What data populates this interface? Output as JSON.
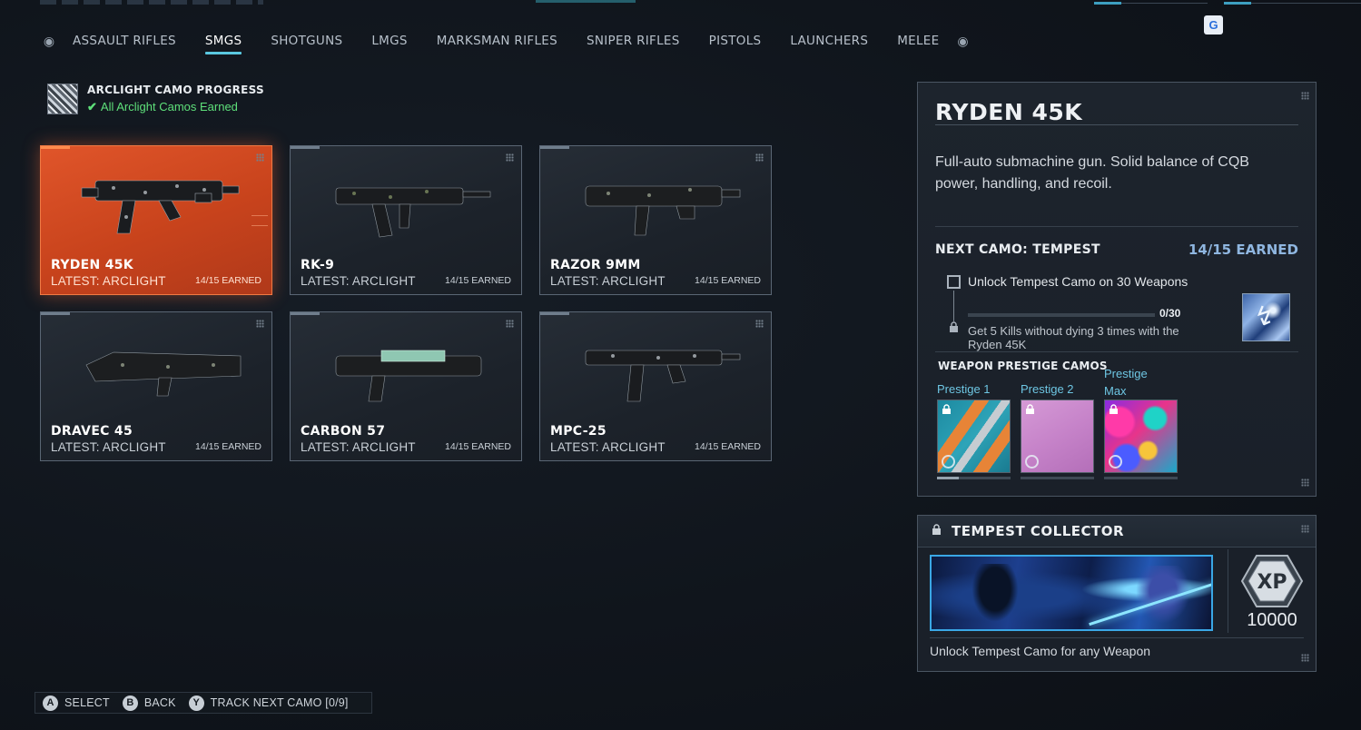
{
  "tabs": {
    "left_icon": "bumper-left-icon",
    "right_icon": "bumper-right-icon",
    "items": [
      "ASSAULT RIFLES",
      "SMGS",
      "SHOTGUNS",
      "LMGS",
      "MARKSMAN RIFLES",
      "SNIPER RIFLES",
      "PISTOLS",
      "LAUNCHERS",
      "MELEE"
    ],
    "active": "SMGS"
  },
  "progress": {
    "title": "ARCLIGHT CAMO PROGRESS",
    "status": "All Arclight Camos Earned",
    "status_color": "#5ee07a"
  },
  "weapons": [
    {
      "name": "RYDEN 45K",
      "latest": "LATEST: ARCLIGHT",
      "earned": "14/15 EARNED",
      "selected": true
    },
    {
      "name": "RK-9",
      "latest": "LATEST: ARCLIGHT",
      "earned": "14/15 EARNED",
      "selected": false
    },
    {
      "name": "RAZOR 9MM",
      "latest": "LATEST: ARCLIGHT",
      "earned": "14/15 EARNED",
      "selected": false
    },
    {
      "name": "DRAVEC 45",
      "latest": "LATEST: ARCLIGHT",
      "earned": "14/15 EARNED",
      "selected": false
    },
    {
      "name": "CARBON 57",
      "latest": "LATEST: ARCLIGHT",
      "earned": "14/15 EARNED",
      "selected": false
    },
    {
      "name": "MPC-25",
      "latest": "LATEST: ARCLIGHT",
      "earned": "14/15 EARNED",
      "selected": false
    }
  ],
  "detail": {
    "title": "RYDEN 45K",
    "description": "Full-auto submachine gun. Solid balance of CQB power, handling, and recoil.",
    "next_camo_label": "NEXT CAMO: TEMPEST",
    "earned": "14/15 EARNED",
    "challenge": {
      "title": "Unlock Tempest Camo on 30 Weapons",
      "progress_text": "0/30",
      "progress_fraction": 0,
      "description": "Get 5 Kills without dying 3 times with the Ryden 45K"
    },
    "prestige_title": "WEAPON PRESTIGE CAMOS",
    "prestige": [
      {
        "label": "Prestige 1",
        "progress_fraction": 0.3
      },
      {
        "label": "Prestige 2",
        "progress_fraction": 0
      },
      {
        "label": "Prestige Max",
        "progress_fraction": 0
      }
    ]
  },
  "collector": {
    "title": "TEMPEST COLLECTOR",
    "xp_label": "XP",
    "xp_value": "10000",
    "description": "Unlock Tempest Camo for any Weapon"
  },
  "prompts": [
    {
      "button": "A",
      "label": "SELECT"
    },
    {
      "button": "B",
      "label": "BACK"
    },
    {
      "button": "Y",
      "label": "TRACK NEXT CAMO [0/9]"
    }
  ],
  "colors": {
    "accent": "#5ac8e0",
    "selected_card": "#d94e24",
    "earned_blue": "#8fb6e0",
    "prestige_label": "#6ec6e3"
  }
}
